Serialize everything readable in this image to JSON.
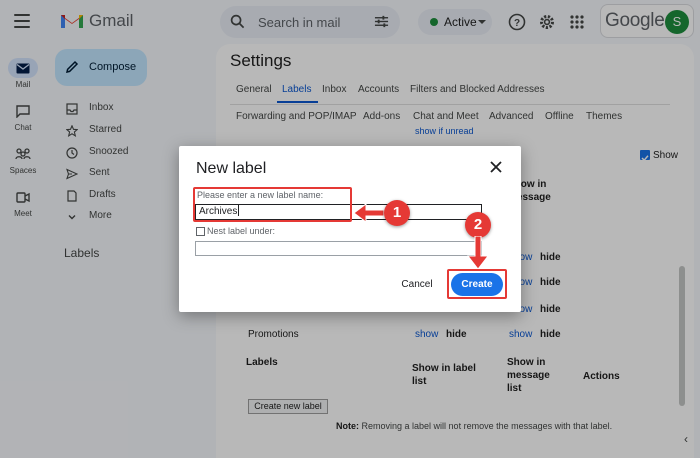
{
  "app": {
    "name": "Gmail"
  },
  "search": {
    "placeholder": "Search in mail"
  },
  "status": {
    "label": "Active",
    "color": "#1e8e3e"
  },
  "account": {
    "brand": "Google",
    "avatar_initial": "S",
    "avatar_color": "#1e8e3e"
  },
  "rail": [
    {
      "label": "Mail",
      "icon": "mail-icon",
      "active": true
    },
    {
      "label": "Chat",
      "icon": "chat-icon"
    },
    {
      "label": "Spaces",
      "icon": "spaces-icon"
    },
    {
      "label": "Meet",
      "icon": "meet-icon"
    }
  ],
  "compose": {
    "label": "Compose"
  },
  "nav": [
    {
      "label": "Inbox",
      "icon": "inbox-icon"
    },
    {
      "label": "Starred",
      "icon": "star-icon"
    },
    {
      "label": "Snoozed",
      "icon": "clock-icon"
    },
    {
      "label": "Sent",
      "icon": "send-icon"
    },
    {
      "label": "Drafts",
      "icon": "draft-icon"
    },
    {
      "label": "More",
      "icon": "chevron-down-icon"
    }
  ],
  "sidebar": {
    "labels_heading": "Labels"
  },
  "settings": {
    "title": "Settings",
    "tabs_row1": [
      "General",
      "Labels",
      "Inbox",
      "Accounts",
      "Filters and Blocked Addresses"
    ],
    "tabs_row2": [
      "Forwarding and POP/IMAP",
      "Add-ons",
      "Chat and Meet",
      "Advanced",
      "Offline",
      "Themes"
    ],
    "active_tab": "Labels",
    "partial_link": "show if unread",
    "show_checkbox_label": "Show",
    "partial_header": "Show in message",
    "row_actions": [
      {
        "show": "show",
        "hide": "hide"
      },
      {
        "show": "show",
        "hide": "hide"
      },
      {
        "show": "show",
        "hide": "hide"
      }
    ],
    "promotions": {
      "name": "Promotions",
      "show": "show",
      "hide": "hide"
    },
    "labels_table": {
      "labels_header": "Labels",
      "show_in_label_list": "Show in label list",
      "show_in_message_list": "Show in message list",
      "actions": "Actions"
    },
    "create_new_label": "Create new label",
    "note_bold": "Note:",
    "note_text": "Removing a label will not remove the messages with that label."
  },
  "dialog": {
    "title": "New label",
    "field_label": "Please enter a new label name:",
    "field_value": "Archives",
    "nest_label": "Nest label under:",
    "cancel": "Cancel",
    "create": "Create"
  },
  "annotations": {
    "step1": "1",
    "step2": "2",
    "color": "#e53935"
  }
}
